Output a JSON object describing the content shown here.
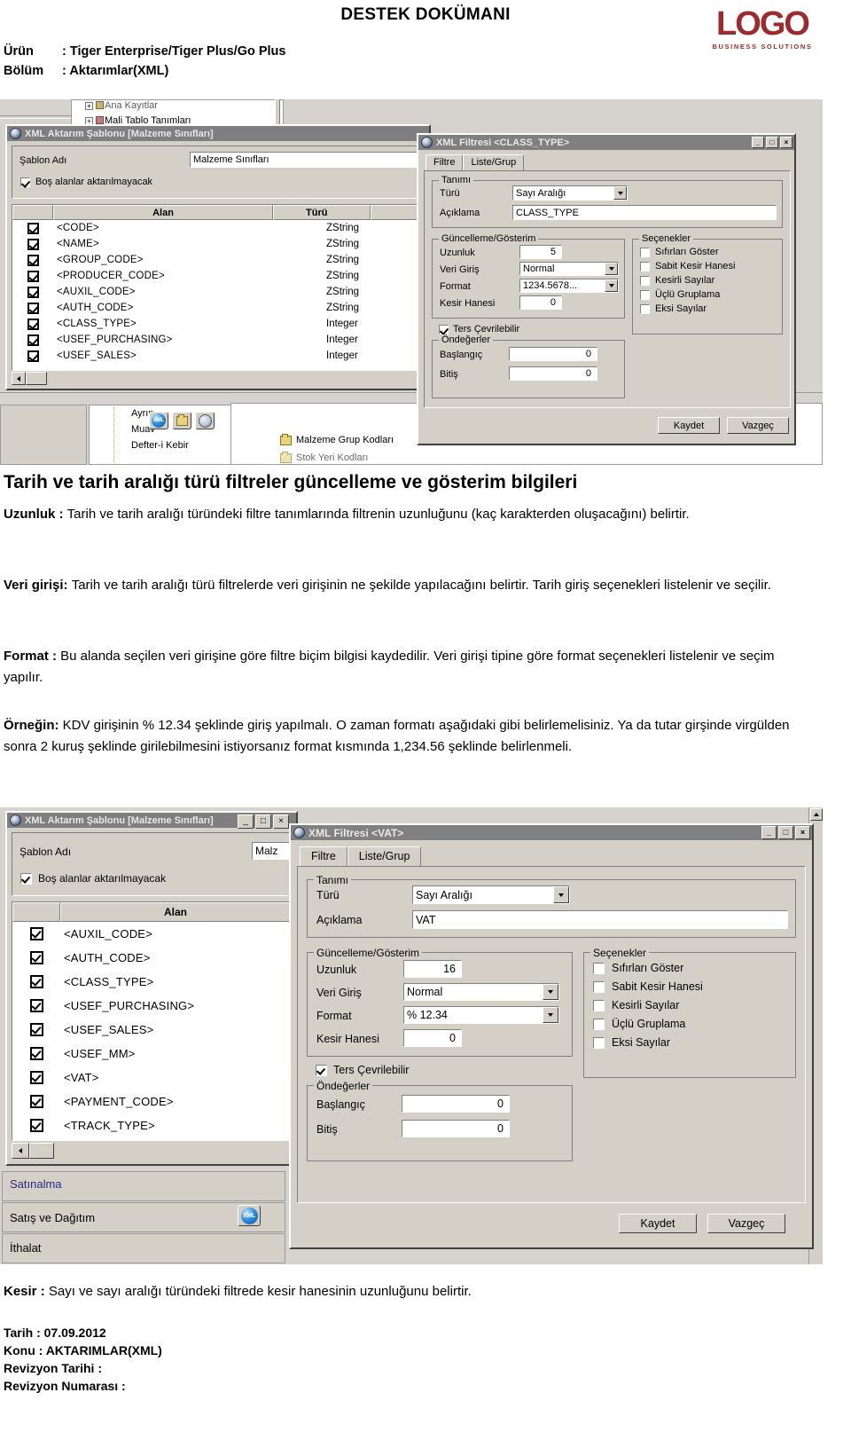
{
  "header": {
    "doc_title": "DESTEK DOKÜMANI",
    "logo_word": "LOGO",
    "logo_sub": "BUSINESS SOLUTIONS",
    "meta": [
      {
        "label": "Ürün",
        "value": ": Tiger Enterprise/Tiger Plus/Go Plus"
      },
      {
        "label": "Bölüm",
        "value": ": Aktarımlar(XML)"
      }
    ]
  },
  "screenshot1": {
    "background_tree": [
      "Ana Kayıtlar",
      "Mali Tablo Tanımları",
      "Ayrın",
      "Muav",
      "Defter-i Kebir",
      "Malzeme Grup Kodları",
      "Stok Yeri Kodları"
    ],
    "template_window": {
      "title": "XML Aktarım Şablonu [Malzeme Sınıfları]",
      "icon": "app-icon",
      "sablon_adi_label": "Şablon Adı",
      "sablon_adi_value": "Malzeme Sınıfları",
      "bos_alanlar_label": "Boş alanlar aktarılmayacak",
      "bos_alanlar_checked": true,
      "grid_headers": [
        "Alan",
        "Türü"
      ],
      "rows": [
        {
          "checked": true,
          "alan": "<CODE>",
          "turu": "ZString"
        },
        {
          "checked": true,
          "alan": "<NAME>",
          "turu": "ZString"
        },
        {
          "checked": true,
          "alan": "<GROUP_CODE>",
          "turu": "ZString"
        },
        {
          "checked": true,
          "alan": "<PRODUCER_CODE>",
          "turu": "ZString"
        },
        {
          "checked": true,
          "alan": "<AUXIL_CODE>",
          "turu": "ZString"
        },
        {
          "checked": true,
          "alan": "<AUTH_CODE>",
          "turu": "ZString"
        },
        {
          "checked": true,
          "alan": "<CLASS_TYPE>",
          "turu": "Integer"
        },
        {
          "checked": true,
          "alan": "<USEF_PURCHASING>",
          "turu": "Integer"
        },
        {
          "checked": true,
          "alan": "<USEF_SALES>",
          "turu": "Integer"
        }
      ]
    },
    "filter_dialog": {
      "title": "XML Filtresi <CLASS_TYPE>",
      "min_label": "_",
      "max_label": "□",
      "close_label": "×",
      "tabs": [
        {
          "label": "Filtre",
          "selected": true
        },
        {
          "label": "Liste/Grup",
          "selected": false
        }
      ],
      "tanimi": {
        "legend": "Tanımı",
        "turu_label": "Türü",
        "turu_value": "Sayı Aralığı",
        "aciklama_label": "Açıklama",
        "aciklama_value": "CLASS_TYPE"
      },
      "guncelleme": {
        "legend": "Güncelleme/Gösterim",
        "uzunluk_label": "Uzunluk",
        "uzunluk_value": "5",
        "veri_giris_label": "Veri Giriş",
        "veri_giris_value": "Normal",
        "format_label": "Format",
        "format_value": "1234.5678...",
        "kesir_label": "Kesir Hanesi",
        "kesir_value": "0",
        "ters_cevrilebilir_label": "Ters Çevrilebilir",
        "ters_cevrilebilir_checked": true
      },
      "secenekler": {
        "legend": "Seçenekler",
        "items": [
          {
            "label": "Sıfırları Göster",
            "checked": false
          },
          {
            "label": "Sabit Kesir Hanesi",
            "checked": false
          },
          {
            "label": "Kesirli Sayılar",
            "checked": false
          },
          {
            "label": "Üçlü Gruplama",
            "checked": false
          },
          {
            "label": "Eksi Sayılar",
            "checked": false
          }
        ]
      },
      "ondegerler": {
        "legend": "Öndeğerler",
        "baslangic_label": "Başlangıç",
        "baslangic_value": "0",
        "bitis_label": "Bitiş",
        "bitis_value": "0"
      },
      "buttons": {
        "save": "Kaydet",
        "cancel": "Vazgeç"
      }
    }
  },
  "article": {
    "section_title": "Tarih ve tarih aralığı türü filtreler güncelleme ve gösterim bilgileri",
    "paragraphs": [
      {
        "lead": "Uzunluk : ",
        "text": "Tarih ve tarih aralığı türündeki filtre tanımlarında filtrenin uzunluğunu (kaç karakterden oluşacağını) belirtir."
      },
      {
        "lead": "Veri girişi: ",
        "text": "Tarih ve tarih aralığı türü filtrelerde veri girişinin ne şekilde yapılacağını belirtir. Tarih giriş seçenekleri listelenir ve seçilir."
      },
      {
        "lead": "Format : ",
        "text": "Bu alanda seçilen veri girişine göre filtre biçim bilgisi kaydedilir. Veri girişi tipine göre format seçenekleri listelenir ve seçim yapılır."
      },
      {
        "lead": "Örneğin: ",
        "text": "KDV girişinin % 12.34 şeklinde giriş yapılmalı. O zaman formatı aşağıdaki gibi belirlemelisiniz. Ya da tutar girşinde virgülden sonra 2 kuruş şeklinde girilebilmesini istiyorsanız format kısmında 1,234.56 şeklinde belirlenmeli."
      }
    ],
    "closing": {
      "lead": "Kesir : ",
      "text": "Sayı ve sayı aralığı türündeki filtrede kesir hanesinin uzunluğunu belirtir."
    }
  },
  "screenshot2": {
    "background_nav": [
      "Satınalma",
      "Satış ve Dağıtım",
      "İthalat"
    ],
    "template_window": {
      "title": "XML Aktarım Şablonu [Malzeme Sınıfları]",
      "min_label": "_",
      "max_label": "□",
      "close_label": "×",
      "sablon_adi_label": "Şablon Adı",
      "sablon_adi_value": "Malz",
      "bos_alanlar_label": "Boş alanlar aktarılmayacak",
      "bos_alanlar_checked": true,
      "grid_header": "Alan",
      "rows": [
        {
          "checked": true,
          "alan": "<AUXIL_CODE>"
        },
        {
          "checked": true,
          "alan": "<AUTH_CODE>"
        },
        {
          "checked": true,
          "alan": "<CLASS_TYPE>"
        },
        {
          "checked": true,
          "alan": "<USEF_PURCHASING>"
        },
        {
          "checked": true,
          "alan": "<USEF_SALES>"
        },
        {
          "checked": true,
          "alan": "<USEF_MM>"
        },
        {
          "checked": true,
          "alan": "<VAT>"
        },
        {
          "checked": true,
          "alan": "<PAYMENT_CODE>"
        },
        {
          "checked": true,
          "alan": "<TRACK_TYPE>"
        }
      ]
    },
    "filter_dialog": {
      "title": "XML Filtresi <VAT>",
      "min_label": "_",
      "max_label": "□",
      "close_label": "×",
      "tabs": [
        {
          "label": "Filtre",
          "selected": true
        },
        {
          "label": "Liste/Grup",
          "selected": false
        }
      ],
      "tanimi": {
        "legend": "Tanımı",
        "turu_label": "Türü",
        "turu_value": "Sayı Aralığı",
        "aciklama_label": "Açıklama",
        "aciklama_value": "VAT"
      },
      "guncelleme": {
        "legend": "Güncelleme/Gösterim",
        "uzunluk_label": "Uzunluk",
        "uzunluk_value": "16",
        "veri_giris_label": "Veri Giriş",
        "veri_giris_value": "Normal",
        "format_label": "Format",
        "format_value": "% 12.34",
        "kesir_label": "Kesir Hanesi",
        "kesir_value": "0",
        "ters_cevrilebilir_label": "Ters Çevrilebilir",
        "ters_cevrilebilir_checked": true
      },
      "secenekler": {
        "legend": "Seçenekler",
        "items": [
          {
            "label": "Sıfırları Göster",
            "checked": false
          },
          {
            "label": "Sabit Kesir Hanesi",
            "checked": false
          },
          {
            "label": "Kesirli Sayılar",
            "checked": false
          },
          {
            "label": "Üçlü Gruplama",
            "checked": false
          },
          {
            "label": "Eksi Sayılar",
            "checked": false
          }
        ]
      },
      "ondegerler": {
        "legend": "Öndeğerler",
        "baslangic_label": "Başlangıç",
        "baslangic_value": "0",
        "bitis_label": "Bitiş",
        "bitis_value": "0"
      },
      "buttons": {
        "save": "Kaydet",
        "cancel": "Vazgeç"
      }
    }
  },
  "footer": {
    "lines": [
      "Tarih : 07.09.2012",
      "Konu : AKTARIMLAR(XML)",
      "Revizyon Tarihi :",
      "Revizyon Numarası :"
    ]
  }
}
